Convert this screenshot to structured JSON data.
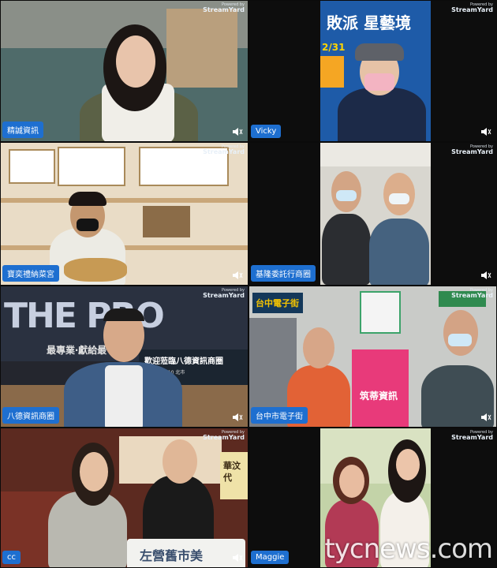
{
  "branding": {
    "powered_by": "Powered by",
    "service": "StreamYard"
  },
  "accent": "#1e6fd0",
  "tiles": [
    {
      "name": "精誠資訊"
    },
    {
      "name": "Vicky",
      "sign": "敗派 星藝境",
      "sign2": "2/31"
    },
    {
      "name": "寶奕禮納菜宮"
    },
    {
      "name": "基隆委託行商圈"
    },
    {
      "name": "八德資訊商圈",
      "sign": "THE PRO",
      "sign2": "最專業‧獻給最",
      "sign3": "歡迎蒞臨八德資訊商圈",
      "sign4": "110 北市"
    },
    {
      "name": "台中市電子街",
      "sign": "台中電子街",
      "sign2": "筑蒂資訊"
    },
    {
      "name": "cc",
      "sign": "左營舊市美",
      "sign2": "華汶 代"
    },
    {
      "name": "Maggie"
    }
  ],
  "watermark": "tycnews.com"
}
